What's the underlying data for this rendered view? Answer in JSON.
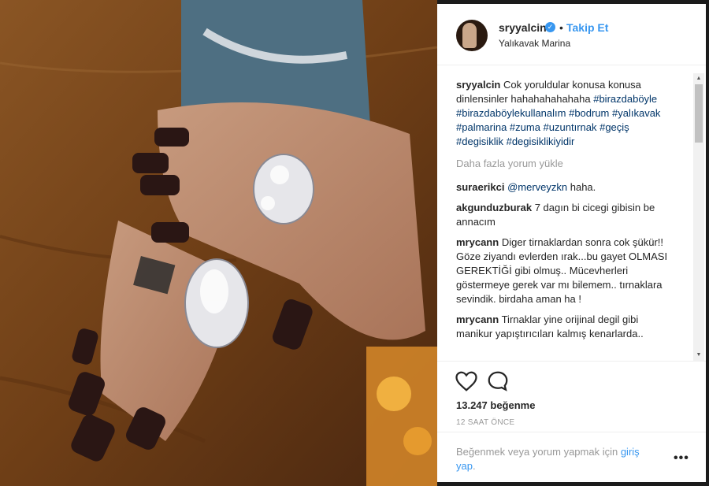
{
  "post": {
    "username": "sryyalcin",
    "follow_label": "Takip Et",
    "location": "Yalıkavak Marina",
    "separator": "•",
    "verified_icon": "verified-badge-icon"
  },
  "caption": {
    "username": "sryyalcin",
    "text": "Cok yoruldular konusa konusa dinlensinler hahahahahahaha",
    "hashtags": "#birazdaböyle #birazdaböylekullanalım #bodrum #yalıkavak #palmarina #zuma #uzuntırnak #geçiş #degisiklik #degisiklikiyidir"
  },
  "load_more": "Daha fazla yorum yükle",
  "comments": [
    {
      "username": "suraerikci",
      "mention": "@merveyzkn",
      "text": "haha."
    },
    {
      "username": "akgunduzburak",
      "mention": "",
      "text": "7 dagın bi cicegi gibisin be annacım"
    },
    {
      "username": "mrycann",
      "mention": "",
      "text": "Diger tirnaklardan sonra cok şükür!! Göze ziyandı evlerden ırak...bu gayet OLMASI GEREKTİĞİ gibi olmuş.. Mücevherleri göstermeye gerek var mı bilemem.. tırnaklara sevindik. birdaha aman ha !"
    },
    {
      "username": "mrycann",
      "mention": "",
      "text": "Tirnaklar yine orijinal degil gibi manikur yapıştırıcıları kalmış kenarlarda.."
    }
  ],
  "stats": {
    "likes": "13.247 beğenme",
    "time": "12 SAAT ÖNCE"
  },
  "footer": {
    "text": "Beğenmek veya yorum yapmak için",
    "link": "giriş yap",
    "end": ".",
    "more": "•••"
  },
  "icons": {
    "heart": "heart-icon",
    "comment": "comment-icon",
    "more": "more-options-icon"
  },
  "colors": {
    "link": "#3897f0",
    "hashtag": "#003569",
    "muted": "#999999",
    "text": "#262626"
  }
}
